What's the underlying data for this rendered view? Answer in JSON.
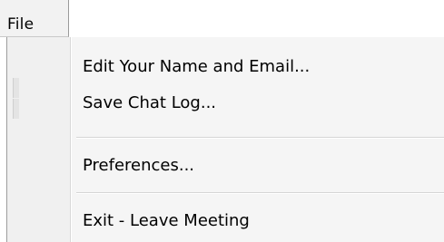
{
  "menubar": {
    "file_label": "File"
  },
  "dropdown": {
    "items": [
      {
        "label": "Edit Your Name and Email..."
      },
      {
        "label": "Save Chat Log..."
      },
      {
        "label": "Preferences..."
      },
      {
        "label": "Exit - Leave Meeting"
      }
    ]
  }
}
